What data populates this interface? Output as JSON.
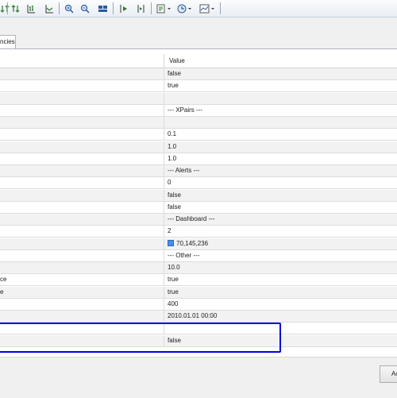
{
  "toolbar": {
    "icons": [
      "sort-icon",
      "bar-chart-icon",
      "line-chart-icon",
      "zoom-in-icon",
      "zoom-out-icon",
      "tile-windows-icon",
      "autoscroll-icon",
      "chart-shift-icon",
      "indicators-icon",
      "timeframes-icon",
      "templates-icon"
    ]
  },
  "tab": {
    "label": "ncies"
  },
  "grid": {
    "value_header": "Value",
    "rows": [
      {
        "name": "",
        "value": "false"
      },
      {
        "name": "",
        "value": "true"
      },
      {
        "name": "",
        "value": ""
      },
      {
        "name": "",
        "value": "--- XPairs ---"
      },
      {
        "name": "",
        "value": ""
      },
      {
        "name": "",
        "value": "0.1"
      },
      {
        "name": "",
        "value": "1.0"
      },
      {
        "name": "",
        "value": "1.0"
      },
      {
        "name": "",
        "value": "--- Alerts ---"
      },
      {
        "name": "",
        "value": "0"
      },
      {
        "name": "",
        "value": "false"
      },
      {
        "name": "",
        "value": "false"
      },
      {
        "name": "",
        "value": "--- Dashboard ---"
      },
      {
        "name": "",
        "value": "2"
      },
      {
        "name": "",
        "value": "70,145,236",
        "color": "#468CEC"
      },
      {
        "name": "",
        "value": "--- Other ---"
      },
      {
        "name": "",
        "value": "10.0"
      },
      {
        "name": "ce",
        "value": "true"
      },
      {
        "name": "e",
        "value": "true"
      },
      {
        "name": "",
        "value": "400"
      },
      {
        "name": "",
        "value": "2010.01.01 00:00"
      },
      {
        "name": "",
        "value": ""
      },
      {
        "name": "",
        "value": "false"
      }
    ]
  },
  "footer": {
    "button_label": "Ac"
  },
  "colors": {
    "highlight": "#0000E8",
    "swatch": "#468CEC"
  }
}
